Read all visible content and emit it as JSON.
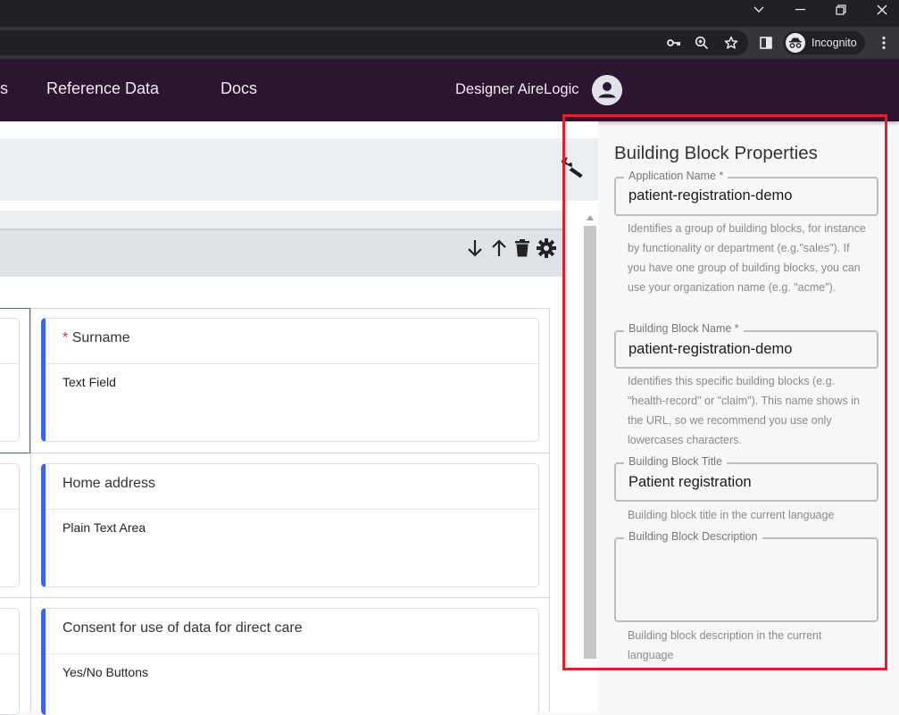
{
  "browser": {
    "window_controls": [
      "chevron-down",
      "minimize",
      "restore",
      "close"
    ],
    "incognito_label": "Incognito",
    "toolbar_icons": [
      "key-icon",
      "zoom-icon",
      "star-icon",
      "side-panel-icon",
      "more-icon"
    ]
  },
  "nav": {
    "partial_item": "s",
    "items": [
      "Reference Data",
      "Docs"
    ],
    "user_name": "Designer AireLogic"
  },
  "section_tools": [
    "arrow-down-icon",
    "arrow-up-icon",
    "trash-icon",
    "gear-icon"
  ],
  "cards": [
    {
      "title": "Surname",
      "required": "*",
      "type": "Text Field"
    },
    {
      "title": "Home address",
      "type": "Plain Text Area"
    },
    {
      "title": "Consent for use of data for direct care",
      "type": "Yes/No Buttons"
    }
  ],
  "properties": {
    "title": "Building Block Properties",
    "fields": [
      {
        "label": "Application Name *",
        "value": "patient-registration-demo",
        "help": "Identifies a group of building blocks, for instance by functionality or department (e.g.\"sales\"). If you have one group of building blocks, you can use your organization name (e.g. \"acme\")."
      },
      {
        "label": "Building Block Name *",
        "value": "patient-registration-demo",
        "help": "Identifies this specific building blocks (e.g. \"health-record\" or \"claim\"). This name shows in the URL, so we recommend you use only lowercases characters."
      },
      {
        "label": "Building Block Title",
        "value": "Patient registration",
        "help": "Building block title in the current language"
      },
      {
        "label": "Building Block Description",
        "value": "",
        "help": "Building block description in the current language"
      }
    ]
  },
  "colors": {
    "nav_bg": "#2b1531",
    "card_accent": "#3d63f0",
    "highlight": "#e0202e",
    "required": "#d32f2f"
  }
}
